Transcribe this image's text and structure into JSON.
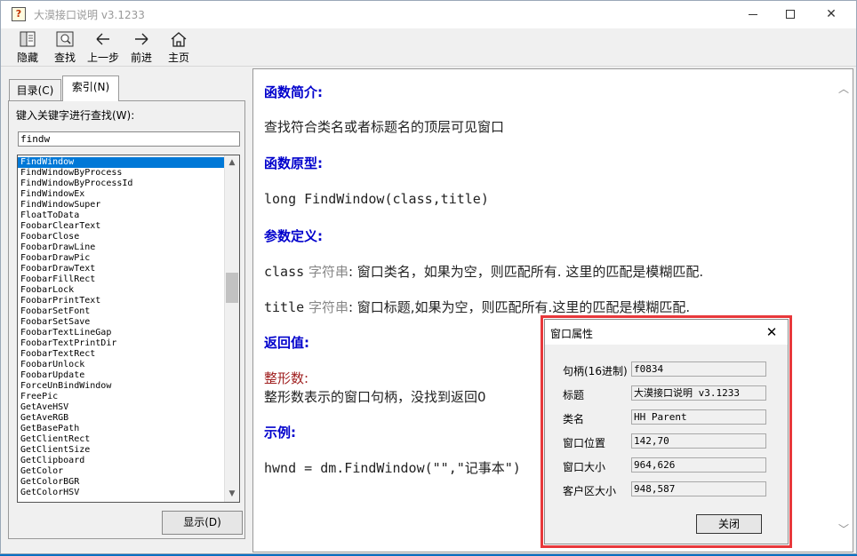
{
  "window": {
    "title": "大漠接口说明 v3.1233"
  },
  "toolbar": {
    "hide": "隐藏",
    "find": "查找",
    "back": "上一步",
    "forward": "前进",
    "home": "主页"
  },
  "left_pane": {
    "tab_toc": "目录(C)",
    "tab_index": "索引(N)",
    "keyword_label": "键入关键字进行查找(W):",
    "keyword_value": "findw",
    "display_button": "显示(D)",
    "items": [
      "FindWindow",
      "FindWindowByProcess",
      "FindWindowByProcessId",
      "FindWindowEx",
      "FindWindowSuper",
      "FloatToData",
      "FoobarClearText",
      "FoobarClose",
      "FoobarDrawLine",
      "FoobarDrawPic",
      "FoobarDrawText",
      "FoobarFillRect",
      "FoobarLock",
      "FoobarPrintText",
      "FoobarSetFont",
      "FoobarSetSave",
      "FoobarTextLineGap",
      "FoobarTextPrintDir",
      "FoobarTextRect",
      "FoobarUnlock",
      "FoobarUpdate",
      "ForceUnBindWindow",
      "FreePic",
      "GetAveHSV",
      "GetAveRGB",
      "GetBasePath",
      "GetClientRect",
      "GetClientSize",
      "GetClipboard",
      "GetColor",
      "GetColorBGR",
      "GetColorHSV"
    ]
  },
  "doc": {
    "h_intro": "函数简介:",
    "intro": "查找符合类名或者标题名的顶层可见窗口",
    "h_proto": "函数原型:",
    "proto": "long FindWindow(class,title)",
    "h_params": "参数定义:",
    "p1_name": "class",
    "p1_type": "字符串",
    "p1_desc": ": 窗口类名，如果为空，则匹配所有. 这里的匹配是模糊匹配.",
    "p2_name": "title",
    "p2_type": "字符串",
    "p2_desc": ": 窗口标题,如果为空，则匹配所有.这里的匹配是模糊匹配.",
    "h_return": "返回值:",
    "ret_type": "整形数:",
    "ret_desc": "整形数表示的窗口句柄，没找到返回0",
    "h_example": "示例:",
    "example": "hwnd = dm.FindWindow(\"\",\"记事本\")"
  },
  "dialog": {
    "title": "窗口属性",
    "labels": [
      "句柄(16进制)",
      "标题",
      "类名",
      "窗口位置",
      "窗口大小",
      "客户区大小"
    ],
    "values": [
      "f0834",
      "大漠接口说明 v3.1233",
      "HH Parent",
      "142,70",
      "964,626",
      "948,587"
    ],
    "close_button": "关闭"
  }
}
